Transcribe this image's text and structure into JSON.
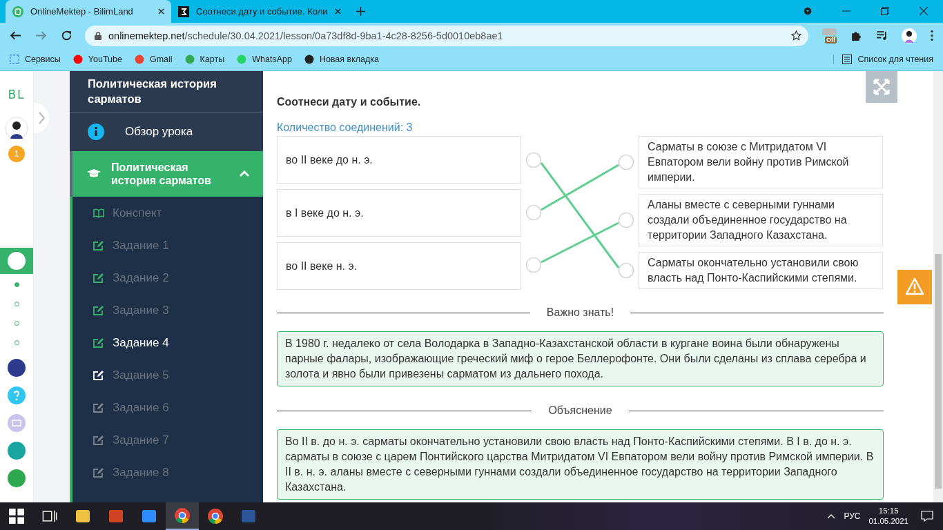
{
  "browser": {
    "tabs": [
      {
        "title": "OnlineMektep - BilimLand",
        "selected": true,
        "kind": "bl"
      },
      {
        "title": "Соотнеси дату и событие. Коли",
        "selected": false,
        "kind": "z"
      }
    ],
    "url_host": "onlinemektep.net",
    "url_path": "/schedule/30.04.2021/lesson/0a73df8d-9ba1-4c28-8256-5d0010eb8ae1",
    "extension_badge": "Off",
    "bookmarks": [
      {
        "label": "Сервисы",
        "kind": "apps"
      },
      {
        "label": "YouTube",
        "kind": "youtube"
      },
      {
        "label": "Gmail",
        "kind": "gmail"
      },
      {
        "label": "Карты",
        "kind": "maps"
      },
      {
        "label": "WhatsApp",
        "kind": "whatsapp"
      },
      {
        "label": "Новая вкладка",
        "kind": "globe"
      }
    ],
    "reading_list": "Список для чтения"
  },
  "rail": {
    "logo": "BL",
    "badge": "1",
    "pager_dots": [
      {
        "selected": true
      },
      {
        "selected": false
      },
      {
        "selected": false
      },
      {
        "selected": false
      }
    ]
  },
  "sidebar": {
    "header": "Политическая история сарматов",
    "overview": "Обзор урока",
    "section": {
      "title": "Политическая история сарматов",
      "expanded": true
    },
    "items": [
      {
        "label": "Конспект",
        "kind": "summary",
        "completed": true,
        "locked": false,
        "selected": false
      },
      {
        "label": "Задание 1",
        "kind": "task",
        "completed": true,
        "locked": false,
        "selected": false
      },
      {
        "label": "Задание 2",
        "kind": "task",
        "completed": true,
        "locked": false,
        "selected": false
      },
      {
        "label": "Задание 3",
        "kind": "task",
        "completed": true,
        "locked": false,
        "selected": false
      },
      {
        "label": "Задание 4",
        "kind": "task",
        "completed": true,
        "locked": false,
        "selected": true
      },
      {
        "label": "Задание 5",
        "kind": "task",
        "completed": false,
        "locked": false,
        "selected": false
      },
      {
        "label": "Задание 6",
        "kind": "task",
        "completed": false,
        "locked": true,
        "selected": false
      },
      {
        "label": "Задание 7",
        "kind": "task",
        "completed": false,
        "locked": true,
        "selected": false
      },
      {
        "label": "Задание 8",
        "kind": "task",
        "completed": false,
        "locked": true,
        "selected": false
      }
    ]
  },
  "task": {
    "title": "Соотнеси дату и событие.",
    "count": "Количество соединений: 3",
    "left": [
      {
        "text": "во II веке до н. э.",
        "links": [
          false,
          false,
          true
        ]
      },
      {
        "text": "в I веке до н. э.",
        "links": [
          true,
          false,
          false
        ]
      },
      {
        "text": "во II веке н. э.",
        "links": [
          false,
          true,
          false
        ]
      }
    ],
    "right": [
      {
        "text": "Сарматы в союзе с Митридатом VI Евпатором вели войну против Римской империи."
      },
      {
        "text": "Аланы вместе с северными гуннами создали объединенное государство на территории Западного Казахстана."
      },
      {
        "text": "Сарматы окончательно установили свою власть над Понто-Каспийскими степями."
      }
    ],
    "important": {
      "heading": "Важно знать!",
      "text": "В 1980 г. недалеко от села Володарка в Западно-Казахстанской области в кургане воина были обнаружены парные фалары, изображающие греческий миф о герое Беллерофонте. Они были сделаны из сплава серебра и золота и явно были привезены сарматом из дальнего похода."
    },
    "explanation": {
      "heading": "Объяснение",
      "text": "Во II в. до н. э. сарматы окончательно установили свою власть над Понто-Каспийскими степями. В I в. до н. э. сарматы в союзе с царем Понтийского царства Митридатом VI Евпатором вели войну против Римской империи. В II в. н. э. аланы вместе с северными гуннами создали объединенное государство на территории Западного Казахстана."
    }
  },
  "taskbar": {
    "apps": [
      {
        "kind": "start",
        "active": false
      },
      {
        "kind": "taskview",
        "active": false
      },
      {
        "kind": "explorer",
        "active": false
      },
      {
        "kind": "powerpoint",
        "active": false
      },
      {
        "kind": "zoom",
        "active": false
      },
      {
        "kind": "chrome",
        "active": true
      },
      {
        "kind": "chrome",
        "active": false
      },
      {
        "kind": "word",
        "active": false
      }
    ],
    "language": "РУС",
    "time": "15:15",
    "date": "01.05.2021"
  }
}
